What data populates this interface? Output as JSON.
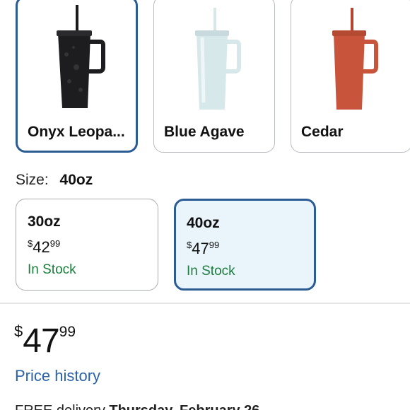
{
  "variants": [
    {
      "label": "Onyx Leopa...",
      "selected": true
    },
    {
      "label": "Blue Agave",
      "selected": false
    },
    {
      "label": "Cedar",
      "selected": false
    }
  ],
  "size": {
    "label": "Size:",
    "value": "40oz",
    "options": [
      {
        "name": "30oz",
        "currency": "$",
        "dollars": "42",
        "cents": "99",
        "stock": "In Stock"
      },
      {
        "name": "40oz",
        "currency": "$",
        "dollars": "47",
        "cents": "99",
        "stock": "In Stock"
      }
    ]
  },
  "price": {
    "currency": "$",
    "dollars": "47",
    "cents": "99"
  },
  "price_history_label": "Price history",
  "delivery": {
    "prefix": "FREE delivery",
    "date": "Thursday, February 26"
  },
  "colors": {
    "accent": "#2b5c94",
    "in_stock": "#1b7e3c",
    "link": "#2b62a8"
  }
}
